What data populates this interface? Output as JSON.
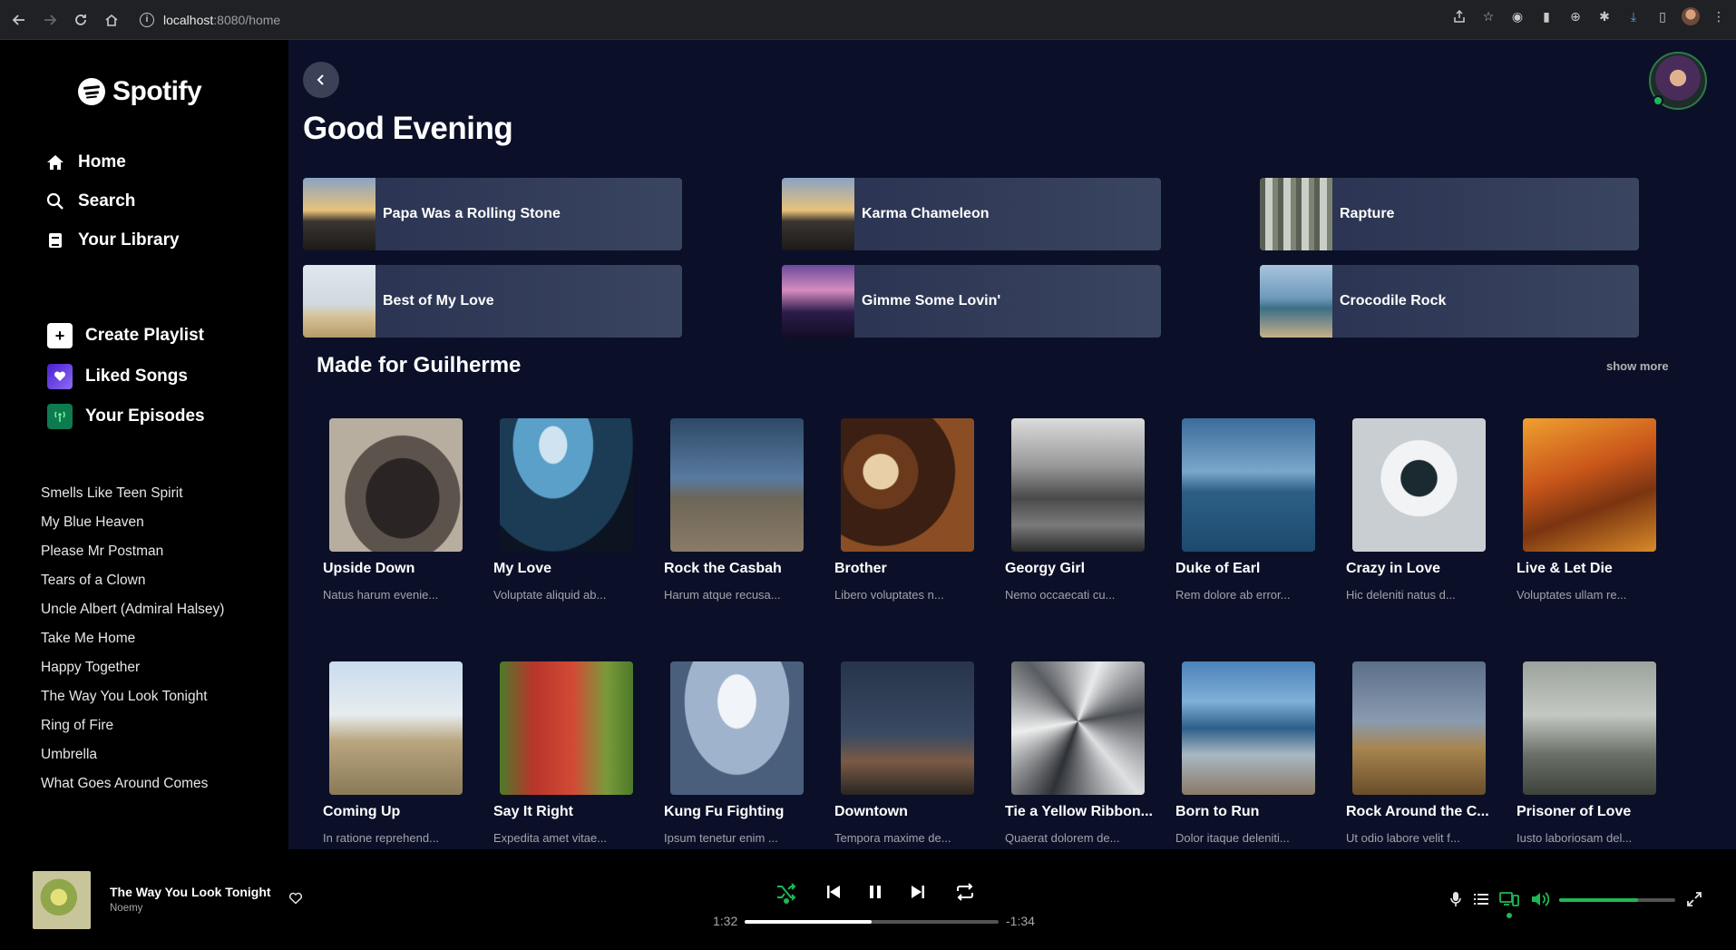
{
  "browser": {
    "url_host": "localhost",
    "url_path": ":8080/home"
  },
  "sidebar": {
    "logo": "Spotify",
    "nav": [
      {
        "label": "Home",
        "icon": "home-icon"
      },
      {
        "label": "Search",
        "icon": "search-icon"
      },
      {
        "label": "Your Library",
        "icon": "library-icon"
      }
    ],
    "actions": [
      {
        "label": "Create Playlist",
        "icon": "plus-icon",
        "color": "#ffffff"
      },
      {
        "label": "Liked Songs",
        "icon": "heart-icon",
        "color": "#6a3ce0"
      },
      {
        "label": "Your Episodes",
        "icon": "podcast-icon",
        "color": "#0d7a4f"
      }
    ],
    "playlists": [
      "Smells Like Teen Spirit",
      "My Blue Heaven",
      "Please Mr Postman",
      "Tears of a Clown",
      "Uncle Albert (Admiral Halsey)",
      "Take Me Home",
      "Happy Together",
      "The Way You Look Tonight",
      "Ring of Fire",
      "Umbrella",
      "What Goes Around Comes"
    ]
  },
  "main": {
    "greeting": "Good Evening",
    "quick_picks": [
      {
        "label": "Papa Was a Rolling Stone"
      },
      {
        "label": "Karma Chameleon"
      },
      {
        "label": "Rapture"
      },
      {
        "label": "Best of My Love"
      },
      {
        "label": "Gimme Some Lovin'"
      },
      {
        "label": "Crocodile Rock"
      }
    ],
    "section": {
      "title": "Made for Guilherme",
      "show_more": "show more"
    },
    "cards": [
      {
        "title": "Upside Down",
        "subtitle": "Natus harum evenie..."
      },
      {
        "title": "My Love",
        "subtitle": "Voluptate aliquid ab..."
      },
      {
        "title": "Rock the Casbah",
        "subtitle": "Harum atque recusa..."
      },
      {
        "title": "Brother",
        "subtitle": "Libero voluptates n..."
      },
      {
        "title": "Georgy Girl",
        "subtitle": "Nemo occaecati cu..."
      },
      {
        "title": "Duke of Earl",
        "subtitle": "Rem dolore ab error..."
      },
      {
        "title": "Crazy in Love",
        "subtitle": "Hic deleniti natus d..."
      },
      {
        "title": "Live & Let Die",
        "subtitle": "Voluptates ullam re..."
      },
      {
        "title": "Coming Up",
        "subtitle": "In ratione reprehend..."
      },
      {
        "title": "Say It Right",
        "subtitle": "Expedita amet vitae..."
      },
      {
        "title": "Kung Fu Fighting",
        "subtitle": "Ipsum tenetur enim ..."
      },
      {
        "title": "Downtown",
        "subtitle": "Tempora maxime de..."
      },
      {
        "title": "Tie a Yellow Ribbon...",
        "subtitle": "Quaerat dolorem de..."
      },
      {
        "title": "Born to Run",
        "subtitle": "Dolor itaque deleniti..."
      },
      {
        "title": "Rock Around the C...",
        "subtitle": "Ut odio labore velit f..."
      },
      {
        "title": "Prisoner of Love",
        "subtitle": "Iusto laboriosam del..."
      }
    ]
  },
  "player": {
    "track_title": "The Way You Look Tonight",
    "artist": "Noemy",
    "elapsed": "1:32",
    "remaining": "-1:34",
    "progress_fraction": 0.5,
    "volume_fraction": 0.68,
    "accent": "#1db954"
  }
}
